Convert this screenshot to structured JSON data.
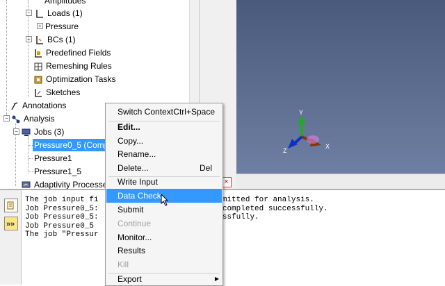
{
  "tree": {
    "amplitudes": "Amplitudes",
    "loads": "Loads (1)",
    "pressure": "Pressure",
    "bcs": "BCs (1)",
    "predefined": "Predefined Fields",
    "remeshing": "Remeshing Rules",
    "optimization": "Optimization Tasks",
    "sketches": "Sketches",
    "annotations": "Annotations",
    "analysis": "Analysis",
    "jobs": "Jobs (3)",
    "job1": "Pressure0_5 (Comp",
    "job2": "Pressure1",
    "job3": "Pressure1_5",
    "adaptivity": "Adaptivity Processe"
  },
  "viewport": {
    "axis_y": "Y",
    "axis_x": "X",
    "axis_z": "Z",
    "colors": {
      "y": "#22aa22",
      "x": "#7a3a10",
      "z": "#1030c0"
    }
  },
  "menu": {
    "switch_context": "Switch Context",
    "switch_context_shortcut": "Ctrl+Space",
    "edit": "Edit...",
    "copy": "Copy...",
    "rename": "Rename...",
    "delete": "Delete...",
    "delete_shortcut": "Del",
    "write_input": "Write Input",
    "data_check": "Data Check",
    "submit": "Submit",
    "continue": "Continue",
    "monitor": "Monitor...",
    "results": "Results",
    "kill": "Kill",
    "export": "Export"
  },
  "messages": {
    "line1": "The job input fi                   been submitted for analysis.",
    "line2": "Job Pressure0_5:                   ocessor completed successfully.",
    "line3": "Job Pressure0_5:                   ed successfully.",
    "line4": "Job Pressure0_5",
    "line5": "The job \"Pressur"
  }
}
